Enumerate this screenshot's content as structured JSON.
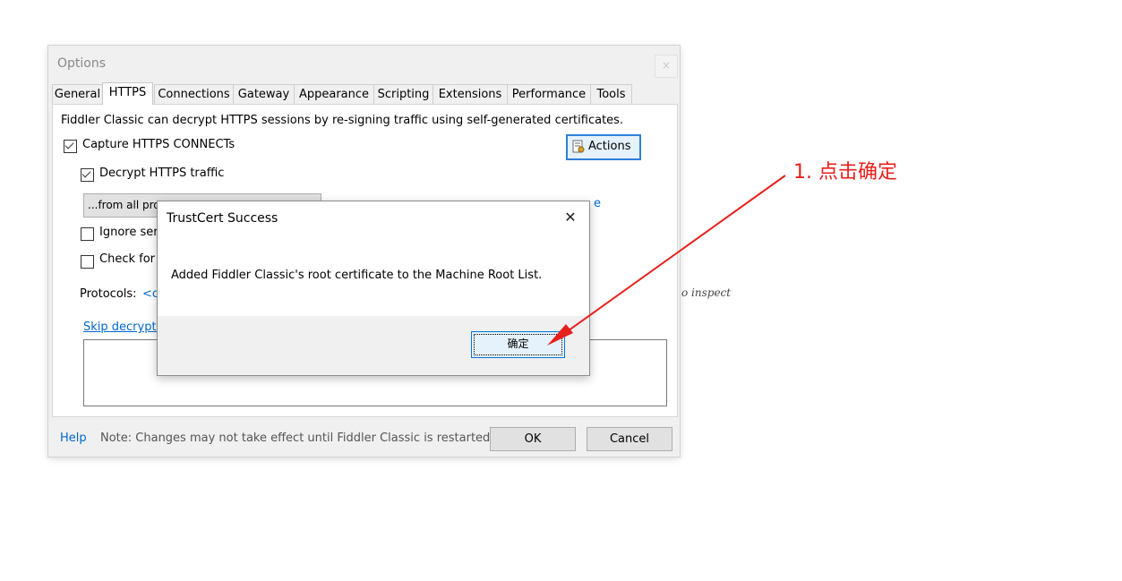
{
  "options_window": {
    "title": "Options",
    "close_glyph": "×",
    "tabs": [
      "General",
      "HTTPS",
      "Connections",
      "Gateway",
      "Appearance",
      "Scripting",
      "Extensions",
      "Performance",
      "Tools"
    ],
    "active_tab": "HTTPS",
    "https": {
      "description": "Fiddler Classic can decrypt HTTPS sessions by re-signing traffic using self-generated certificates.",
      "capture_label": "Capture HTTPS CONNECTs",
      "capture_checked": true,
      "actions_label": "Actions",
      "decrypt_label": "Decrypt HTTPS traffic",
      "decrypt_checked": true,
      "process_filter_value": "...from all pro",
      "cert_link_partial": "e",
      "ignore_label_partial": "Ignore ser",
      "check_label_partial": "Check for c",
      "protocols_label": "Protocols:",
      "protocols_value_partial": "<cl",
      "inspect_partial": "o inspect",
      "skip_link_partial": "Skip decrypti"
    },
    "footer": {
      "help_label": "Help",
      "note": "Note: Changes may not take effect until Fiddler Classic is restarted.",
      "ok_label": "OK",
      "cancel_label": "Cancel"
    }
  },
  "dialog": {
    "title": "TrustCert Success",
    "close_glyph": "✕",
    "message": "Added Fiddler Classic's root certificate to the Machine Root List.",
    "ok_label": "确定"
  },
  "annotation": {
    "text": "1. 点击确定",
    "color": "#e8201c"
  }
}
